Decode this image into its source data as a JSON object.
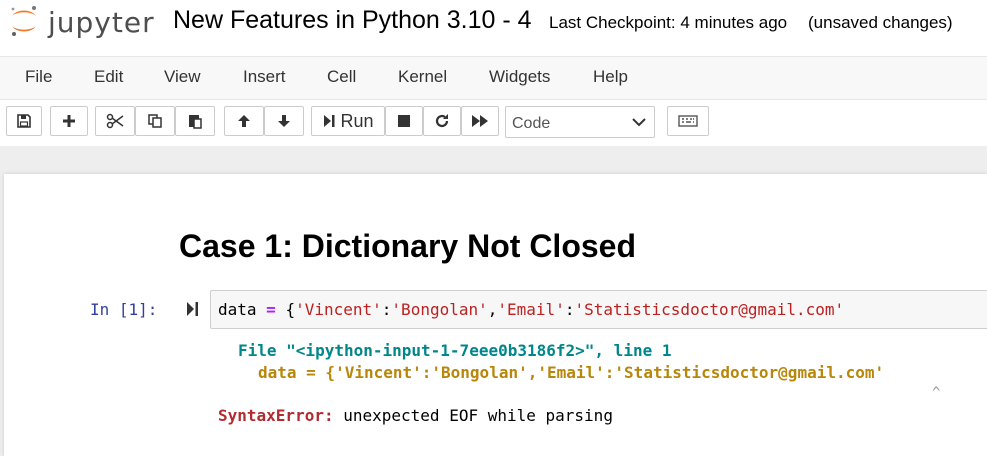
{
  "header": {
    "logo_text": "jupyter",
    "notebook_title": "New Features in Python 3.10 - 4",
    "checkpoint": "Last Checkpoint: 4 minutes ago",
    "unsaved": "(unsaved changes)"
  },
  "menu": [
    "File",
    "Edit",
    "View",
    "Insert",
    "Cell",
    "Kernel",
    "Widgets",
    "Help"
  ],
  "toolbar": {
    "buttons": [
      "save-icon",
      "plus-icon",
      "cut-icon",
      "copy-icon",
      "paste-icon",
      "arrow-up-icon",
      "arrow-down-icon",
      "run-icon",
      "stop-icon",
      "restart-icon",
      "fast-forward-icon",
      "keyboard-icon"
    ],
    "run_label": "Run",
    "cell_type": "Code"
  },
  "notebook": {
    "heading": "Case 1: Dictionary Not Closed",
    "prompt": "In [1]:",
    "code": {
      "var": "data ",
      "op": "=",
      "open": " {",
      "k1": "'Vincent'",
      "colon1": ":",
      "v1": "'Bongolan'",
      "comma": ",",
      "k2": "'Email'",
      "colon2": ":",
      "v2": "'Statisticsdoctor@gmail.com'"
    },
    "output": {
      "file_line": "File \"<ipython-input-1-7eee0b3186f2>\", line 1",
      "code_line": "data = {'Vincent':'Bongolan','Email':'Statisticsdoctor@gmail.com'",
      "caret": "^",
      "error_name": "SyntaxError:",
      "error_msg": " unexpected EOF while parsing"
    }
  }
}
